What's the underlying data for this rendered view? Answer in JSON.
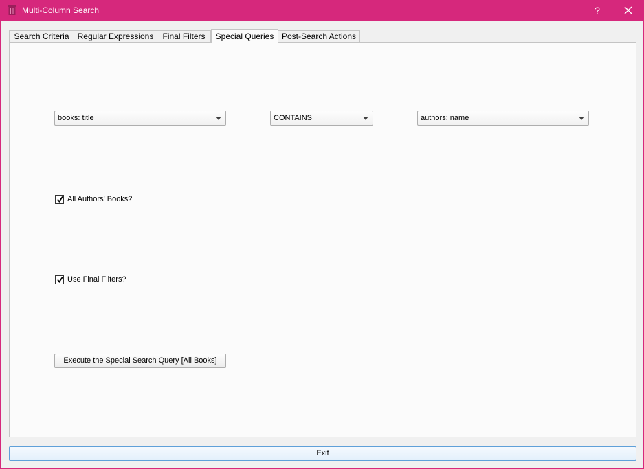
{
  "window": {
    "title": "Multi-Column Search",
    "help_label": "?"
  },
  "tabs": [
    {
      "label": "Search Criteria",
      "active": false
    },
    {
      "label": "Regular Expressions",
      "active": false
    },
    {
      "label": "Final Filters",
      "active": false
    },
    {
      "label": "Special Queries",
      "active": true
    },
    {
      "label": "Post-Search Actions",
      "active": false
    }
  ],
  "special_queries": {
    "left_column_select": "books: title",
    "operator_select": "CONTAINS",
    "right_column_select": "authors: name",
    "all_authors_books": {
      "label": "All Authors' Books?",
      "checked": true
    },
    "use_final_filters": {
      "label": "Use Final Filters?",
      "checked": true
    },
    "execute_button": "Execute the Special Search Query [All Books]"
  },
  "footer": {
    "exit_label": "Exit"
  },
  "colors": {
    "titlebar": "#d6287c",
    "exit_border": "#5fa0d9"
  },
  "icons": {
    "app": "trash-column-icon",
    "close": "close-icon",
    "dropdown": "chevron-down-icon",
    "check": "checkmark-icon"
  }
}
